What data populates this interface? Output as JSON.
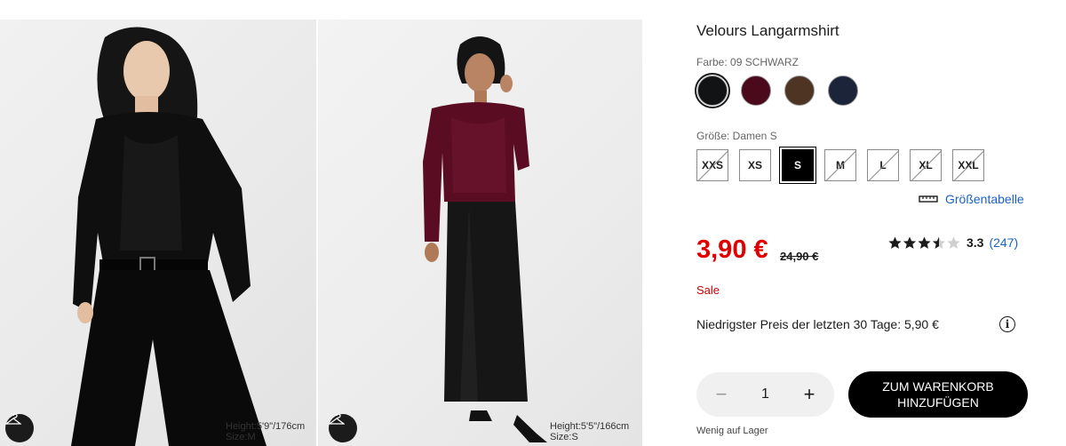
{
  "gallery": {
    "photo1": {
      "model_height": "Height:5'9\"/176cm",
      "model_size": "Size:M",
      "garment_color": "#0d0d0d"
    },
    "photo2": {
      "model_height": "Height:5'5\"/166cm",
      "model_size": "Size:S",
      "garment_color": "#5a0d22"
    }
  },
  "product": {
    "title": "Velours Langarmshirt",
    "color_label": "Farbe: 09 SCHWARZ",
    "colors": [
      {
        "name": "schwarz",
        "hex": "#111315",
        "selected": true
      },
      {
        "name": "weinrot",
        "hex": "#4a0a1c",
        "selected": false
      },
      {
        "name": "braun",
        "hex": "#4e3523",
        "selected": false
      },
      {
        "name": "navy",
        "hex": "#1c243a",
        "selected": false
      }
    ],
    "size_label": "Größe: Damen S",
    "sizes": [
      {
        "label": "XXS",
        "state": "disabled"
      },
      {
        "label": "XS",
        "state": "available"
      },
      {
        "label": "S",
        "state": "selected"
      },
      {
        "label": "M",
        "state": "disabled"
      },
      {
        "label": "L",
        "state": "disabled"
      },
      {
        "label": "XL",
        "state": "disabled"
      },
      {
        "label": "XXL",
        "state": "disabled"
      }
    ],
    "size_chart_label": "Größentabelle",
    "price": "3,90 €",
    "old_price": "24,90 €",
    "rating_value": "3.3",
    "rating_stars": 3.5,
    "rating_count": "(247)",
    "sale_label": "Sale",
    "lowest_price": "Niedrigster Preis der letzten 30 Tage: 5,90 €",
    "quantity": "1",
    "qty_minus": "−",
    "qty_plus": "+",
    "cart_line1": "ZUM WARENKORB",
    "cart_line2": "HINZUFÜGEN",
    "stock": "Wenig auf Lager"
  },
  "colors": {
    "price_red": "#e00000",
    "link_blue": "#1a63c5",
    "dark": "#1b1b1b"
  }
}
